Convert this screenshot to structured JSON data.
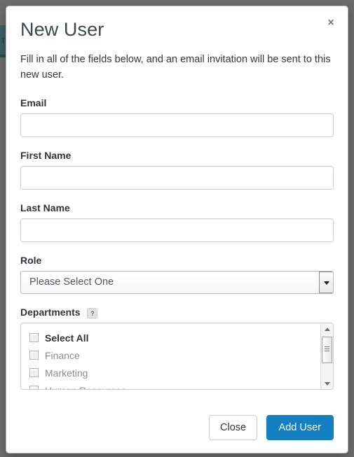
{
  "modal": {
    "title": "New User",
    "close_label": "×",
    "intro": "Fill in all of the fields below, and an email invitation will be sent to this new user.",
    "fields": {
      "email": {
        "label": "Email",
        "value": "",
        "placeholder": ""
      },
      "first_name": {
        "label": "First Name",
        "value": "",
        "placeholder": ""
      },
      "last_name": {
        "label": "Last Name",
        "value": "",
        "placeholder": ""
      },
      "role": {
        "label": "Role",
        "selected": "Please Select One"
      },
      "departments": {
        "label": "Departments",
        "help_badge": "?",
        "items": [
          {
            "label": "Select All",
            "checked": false,
            "emphasis": true
          },
          {
            "label": "Finance",
            "checked": false,
            "emphasis": false
          },
          {
            "label": "Marketing",
            "checked": false,
            "emphasis": false
          },
          {
            "label": "Human Resources",
            "checked": false,
            "emphasis": false
          }
        ]
      }
    },
    "footer": {
      "close_button": "Close",
      "submit_button": "Add User"
    }
  },
  "background": {
    "page_letter": "T"
  },
  "colors": {
    "primary": "#1380c4",
    "sidebar": "#3d5f66",
    "overlay": "#6d6d6d",
    "border": "#cfcfcf",
    "text": "#2f3438"
  }
}
